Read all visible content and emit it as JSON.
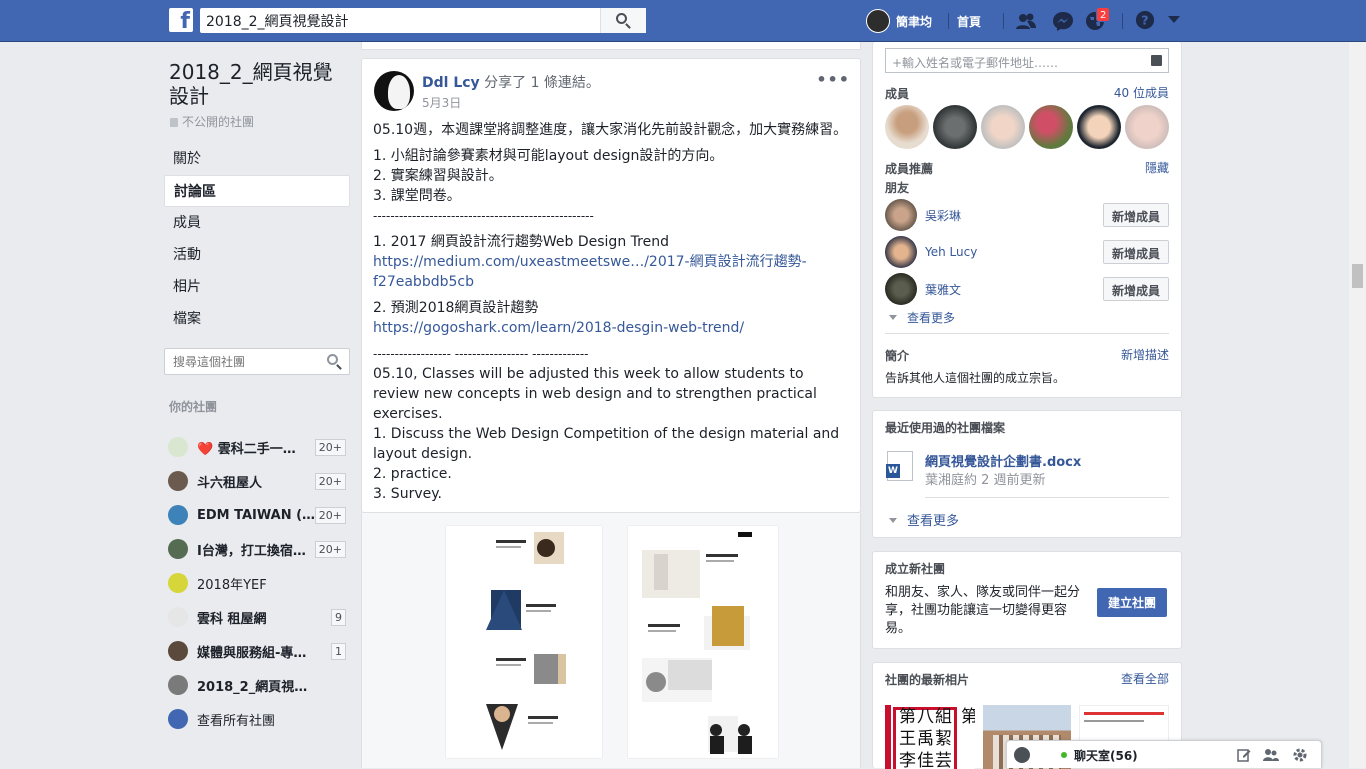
{
  "topbar": {
    "search_value": "2018_2_網頁視覺設計",
    "user_name": "簡聿均",
    "home_label": "首頁",
    "notifications_count": "2",
    "colors": {
      "bar": "#4267b2",
      "badge": "#fa3e3e"
    }
  },
  "group": {
    "title": "2018_2_網頁視覺設計",
    "privacy": "不公開的社團",
    "nav": [
      "關於",
      "討論區",
      "成員",
      "活動",
      "相片",
      "檔案"
    ],
    "active_nav": "討論區",
    "search_placeholder": "搜尋這個社團"
  },
  "your_groups": {
    "heading": "你的社團",
    "items": [
      {
        "name": "❤️ 雲科二手一…",
        "count": "20+"
      },
      {
        "name": "斗六租屋人",
        "count": "20+"
      },
      {
        "name": "EDM TAIWAN (…",
        "count": "20+"
      },
      {
        "name": "I台灣，打工換宿…",
        "count": "20+"
      },
      {
        "name": "2018年YEF",
        "count": ""
      },
      {
        "name": "雲科 租屋網",
        "count": "9"
      },
      {
        "name": "媒體與服務組-專…",
        "count": "1"
      },
      {
        "name": "2018_2_網頁視覺設計",
        "count": ""
      },
      {
        "name": "查看所有社團",
        "count": ""
      }
    ]
  },
  "post": {
    "author": "Ddl Lcy",
    "action": " 分享了 1 條連結。",
    "date": "5月3日",
    "more": "•••",
    "p1": "05.10週，本週課堂將調整進度，讓大家消化先前設計觀念，加大實務練習。",
    "list1": [
      "1. 小組討論參賽素材與可能layout design設計的方向。",
      "2. 實案練習與設計。",
      "3. 課堂問卷。"
    ],
    "divider1": "---------------------------------------------------",
    "item_a": "1. 2017 網頁設計流行趨勢Web Design Trend",
    "link_a": "https://medium.com/uxeastmeetswe…/2017-網頁設計流行趨勢-f27eabbdb5cb",
    "item_b": "2. 預測2018網頁設計趨勢",
    "link_b": "https://gogoshark.com/learn/2018-desgin-web-trend/",
    "divider2": "------------------ ----------------- -------------",
    "en_p": "05.10, Classes will be adjusted this week to allow students to review new concepts in web design and to strengthen practical exercises.",
    "en_list": [
      "1. Discuss the Web Design Competition of the design material and layout design.",
      "2. practice.",
      "3. Survey."
    ]
  },
  "members": {
    "add_placeholder": "+輸入姓名或電子郵件地址……",
    "heading": "成員",
    "count_label": "40 位成員",
    "suggest_heading": "成員推薦",
    "hide": "隱藏",
    "friends_label": "朋友",
    "suggestions": [
      {
        "name": "吳彩琳",
        "button": "新增成員"
      },
      {
        "name": "Yeh Lucy",
        "button": "新增成員"
      },
      {
        "name": "葉雅文",
        "button": "新增成員"
      }
    ],
    "see_more": "查看更多",
    "intro_heading": "簡介",
    "intro_add": "新增描述",
    "intro_text": "告訴其他人這個社團的成立宗旨。"
  },
  "files": {
    "heading": "最近使用過的社團檔案",
    "file_name": "網頁視覺設計企劃書.docx",
    "file_meta": "葉湘庭約 2 週前更新",
    "file_icon_letter": "W",
    "see_more": "查看更多"
  },
  "create": {
    "heading": "成立新社團",
    "text": "和朋友、家人、隊友或同伴一起分享，社團功能讓這一切變得更容易。",
    "button": "建立社團"
  },
  "photos": {
    "heading": "社團的最新相片",
    "see_all": "查看全部",
    "thumb1_lines": [
      "第八組",
      "王禹絜",
      "李佳芸"
    ],
    "thumb1_side": "第"
  },
  "chat": {
    "label": "聊天室(56)"
  }
}
